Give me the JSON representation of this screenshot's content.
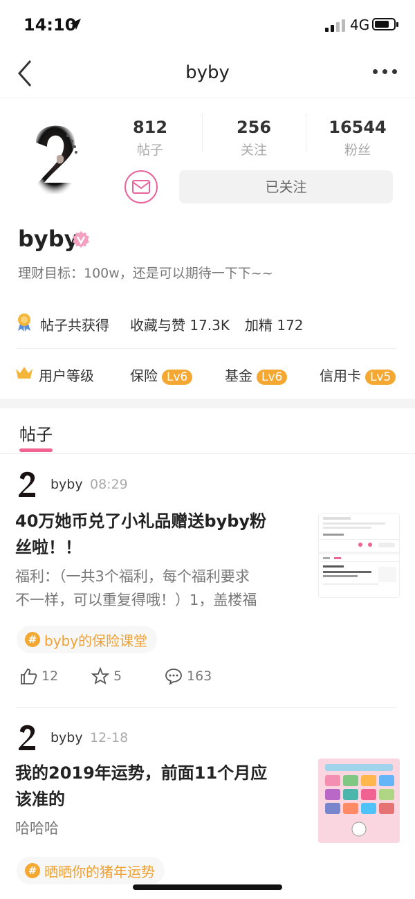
{
  "status": {
    "time": "14:10",
    "network": "4G"
  },
  "nav": {
    "title": "byby"
  },
  "profile": {
    "stats": [
      {
        "num": "812",
        "label": "帖子"
      },
      {
        "num": "256",
        "label": "关注"
      },
      {
        "num": "16544",
        "label": "粉丝"
      }
    ],
    "follow_label": "已关注",
    "name": "byby",
    "bio": "理财目标：100w，还是可以期待一下下~~",
    "achievement_label": "帖子共获得",
    "favs_label": "收藏与赞 17.3K",
    "essence_label": "加精 172",
    "level_label": "用户等级",
    "levels": [
      {
        "name": "保险",
        "lv": "Lv6"
      },
      {
        "name": "基金",
        "lv": "Lv6"
      },
      {
        "name": "信用卡",
        "lv": "Lv5"
      }
    ]
  },
  "tabs": {
    "posts": "帖子"
  },
  "posts": [
    {
      "author": "byby",
      "time": "08:29",
      "title_l1": "40万她币兑了小礼品赠送byby粉",
      "title_l2": "丝啦！！",
      "body_l1": "福利：（一共3个福利，每个福利要求",
      "body_l2": "不一样，可以重复得哦！）1，盖楼福",
      "tag": "byby的保险课堂",
      "likes": "12",
      "stars": "5",
      "comments": "163"
    },
    {
      "author": "byby",
      "time": "12-18",
      "title_l1": "我的2019年运势，前面11个月应",
      "title_l2": "该准的",
      "body_l1": "哈哈哈",
      "tag": "晒晒你的猪年运势"
    }
  ],
  "colors": {
    "accent": "#f0628f",
    "level": "#f4a731",
    "tag": "#f0a132"
  }
}
